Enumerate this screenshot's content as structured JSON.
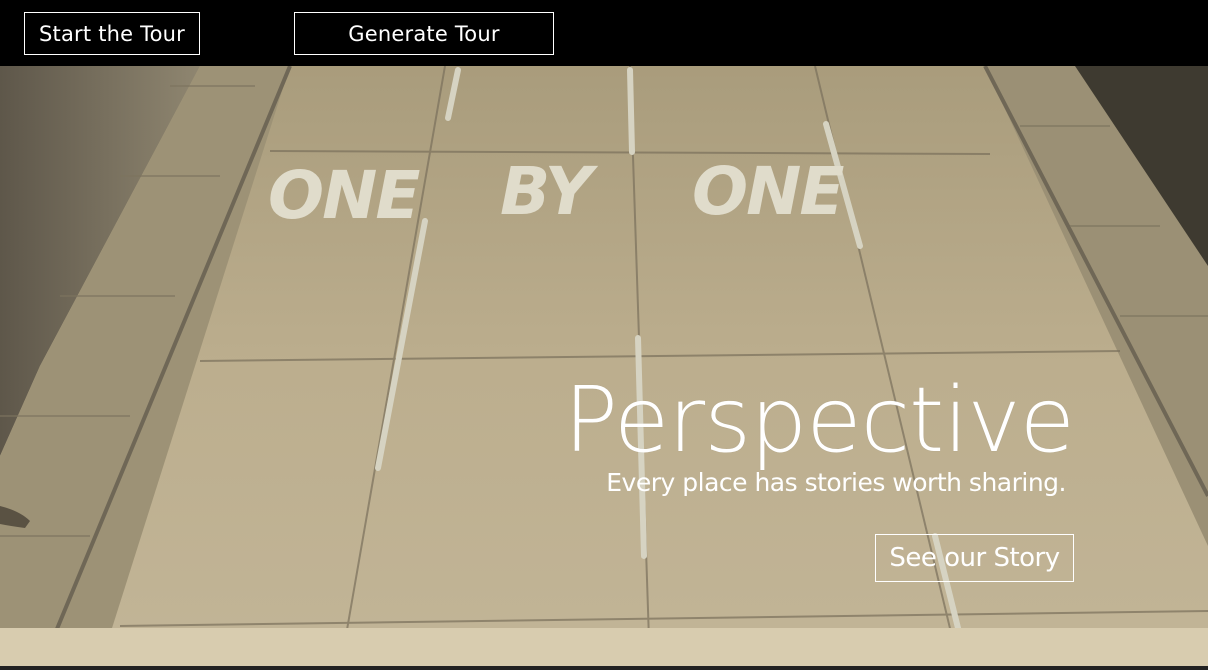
{
  "nav": {
    "start_tour_label": "Start the Tour",
    "generate_tour_label": "Generate Tour"
  },
  "hero": {
    "title": "Perspective",
    "subtitle": "Every place has stories worth sharing.",
    "cta_label": "See our Story",
    "road_words": [
      "ONE",
      "BY",
      "ONE"
    ]
  },
  "colors": {
    "topbar": "#000000",
    "road": "#b9ac8c",
    "sidewalk": "#a2977b",
    "text": "#ffffff"
  }
}
